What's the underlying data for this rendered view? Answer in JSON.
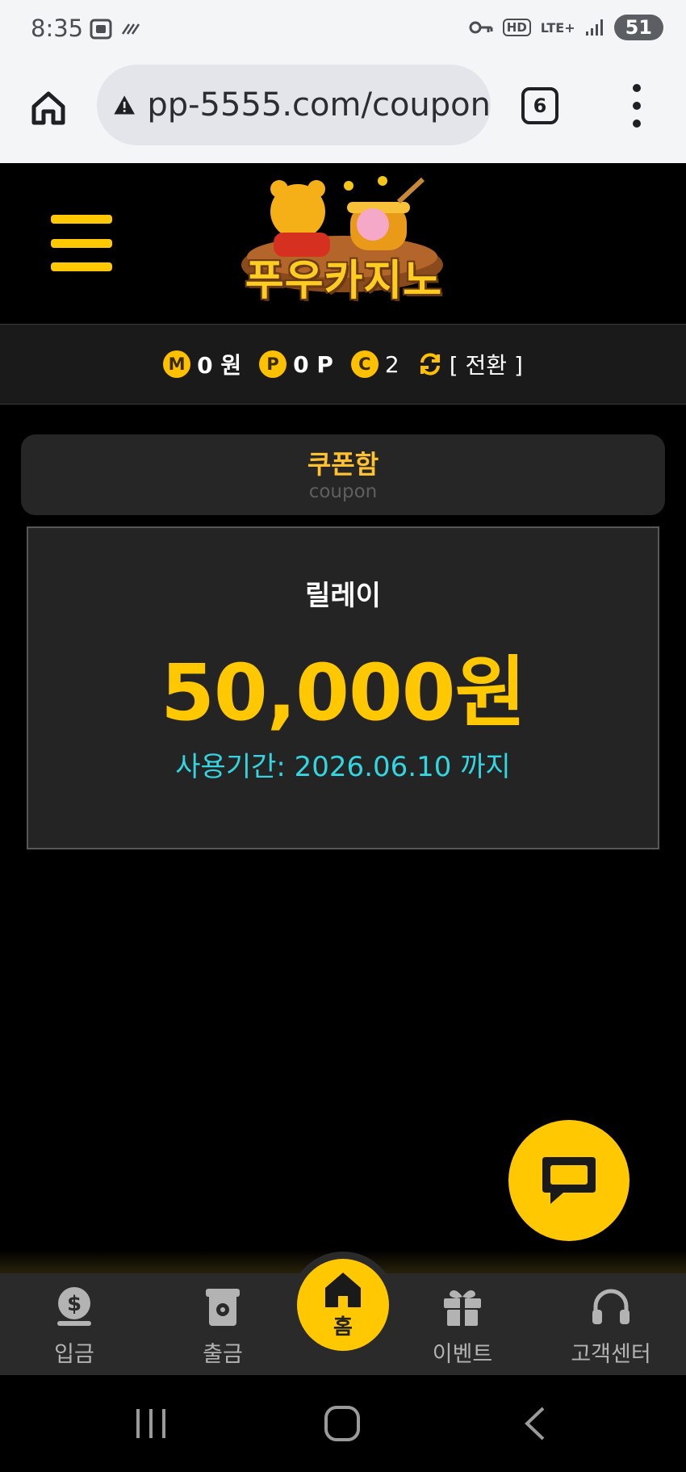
{
  "status_bar": {
    "time": "8:35",
    "network": "LTE+",
    "hd": "HD",
    "battery": "51"
  },
  "browser": {
    "url": "pp-5555.com/coupon",
    "tab_count": "6"
  },
  "header": {
    "logo_text": "푸우카지노"
  },
  "balance": {
    "money_icon": "M",
    "money_value": "0 원",
    "point_icon": "P",
    "point_value": "0 P",
    "coupon_icon": "C",
    "coupon_value": "2",
    "swap_label": "[ 전환 ]"
  },
  "coupon_box": {
    "title": "쿠폰함",
    "subtitle": "coupon"
  },
  "coupon_card": {
    "name": "릴레이",
    "amount": "50,000원",
    "period": "사용기간: 2026.06.10 까지"
  },
  "bottom_nav": {
    "items": [
      {
        "label": "입금",
        "icon": "deposit-icon"
      },
      {
        "label": "출금",
        "icon": "withdraw-icon"
      },
      {
        "label": "홈",
        "icon": "home-icon"
      },
      {
        "label": "이벤트",
        "icon": "gift-icon"
      },
      {
        "label": "고객센터",
        "icon": "headset-icon"
      }
    ]
  },
  "colors": {
    "accent": "#ffc800",
    "period_text": "#33d6e0",
    "background": "#000000"
  }
}
